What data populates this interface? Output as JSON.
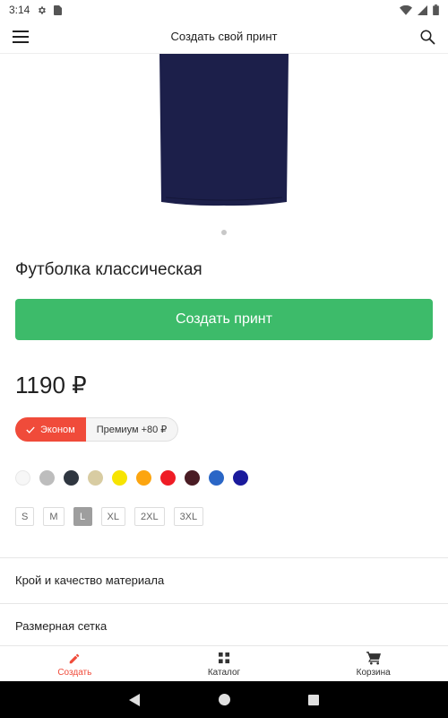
{
  "status_bar": {
    "time": "3:14",
    "icons": [
      "gear-icon",
      "sim-card-icon",
      "wifi-icon",
      "signal-icon",
      "battery-icon"
    ]
  },
  "app_bar": {
    "title": "Создать свой принт",
    "icons": [
      "menu-icon",
      "search-icon"
    ]
  },
  "product": {
    "title": "Футболка классическая",
    "create_button": "Создать принт",
    "price": "1190 ₽",
    "variants": [
      {
        "label": "Эконом",
        "active": true
      },
      {
        "label": "Премиум +80 ₽",
        "active": false
      }
    ],
    "colors": [
      "#f7f7f7",
      "#bdbdbd",
      "#2f3640",
      "#d8cca2",
      "#f7e400",
      "#fca510",
      "#ef1c25",
      "#4a1c24",
      "#2a66c6",
      "#1a1a9c"
    ],
    "sizes": [
      "S",
      "M",
      "L",
      "XL",
      "2XL",
      "3XL"
    ],
    "selected_size": "L",
    "image_color": "#1c1f4a"
  },
  "sections": {
    "fit_quality": "Крой и качество материала",
    "size_chart": "Размерная сетка"
  },
  "bottom_nav": {
    "create": "Создать",
    "catalog": "Каталог",
    "cart": "Корзина"
  },
  "colors": {
    "accent": "#f04b3a",
    "primary_button": "#3dbb6a"
  }
}
